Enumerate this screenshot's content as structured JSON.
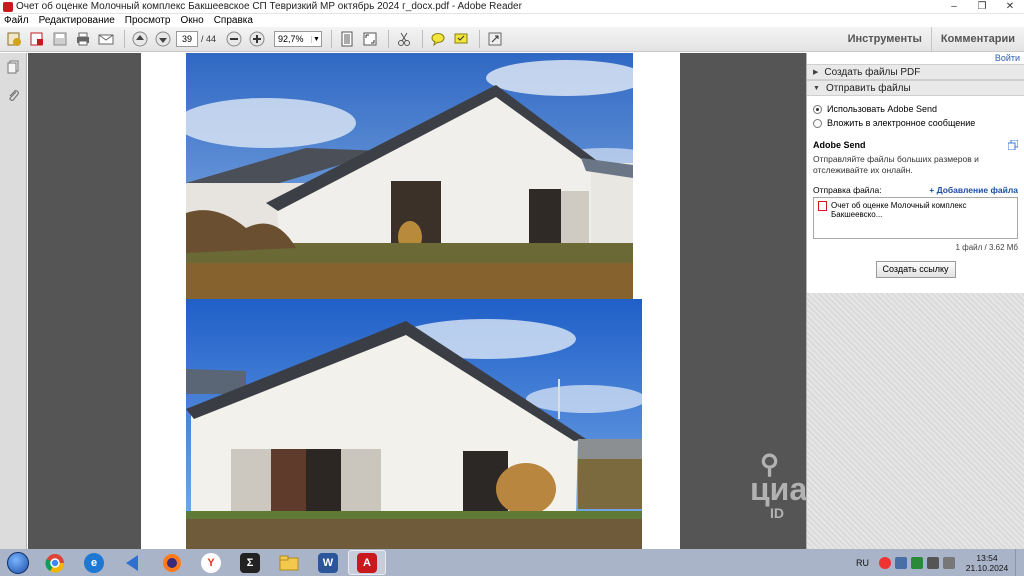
{
  "window": {
    "title": "Очет об оценке  Молочный комплекс Бакшеевское СП Тевризкий МР октябрь 2024 г_docx.pdf - Adobe Reader",
    "controls": [
      "–",
      "❐",
      "✕"
    ]
  },
  "menu": [
    "Файл",
    "Редактирование",
    "Просмотр",
    "Окно",
    "Справка"
  ],
  "toolbar": {
    "page_current": "39",
    "page_total": "/ 44",
    "zoom": "92,7%",
    "tools_label": "Инструменты",
    "comments_label": "Комментарии"
  },
  "right_pane": {
    "login": "Войти",
    "create_pdf": "Создать файлы PDF",
    "send_files": "Отправить файлы",
    "option_adobe_send": "Использовать Adobe Send",
    "option_email": "Вложить в электронное сообщение",
    "adobe_send_title": "Adobe Send",
    "adobe_send_desc": "Отправляйте файлы больших размеров и отслеживайте их онлайн.",
    "file_send_label": "Отправка файла:",
    "add_file": "+ Добавление файла",
    "file_name": "Очет об оценке  Молочный комплекс Бакшеевско...",
    "file_count": "1 файл / 3.62 Мб",
    "create_link": "Создать ссылку"
  },
  "taskbar": {
    "lang": "RU",
    "time": "13:54",
    "date": "21.10.2024"
  },
  "watermark": {
    "brand": "циан",
    "id": "ID"
  },
  "colors": {
    "doc_bg": "#555555",
    "accent_pdf": "#c8191e",
    "link": "#2a5db0"
  }
}
